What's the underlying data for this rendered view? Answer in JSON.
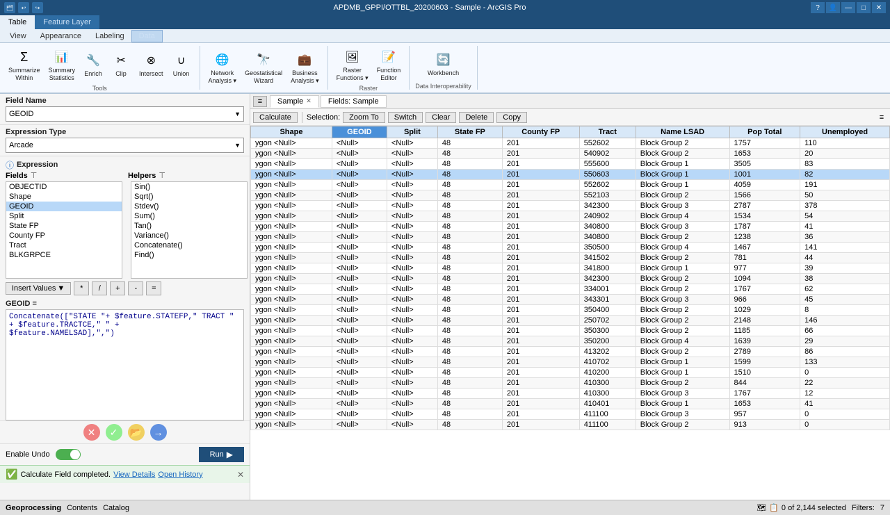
{
  "titleBar": {
    "title": "APDMB_GPPI/OTTBL_20200603 - Sample - ArcGIS Pro",
    "helpIcon": "?",
    "minimizeIcon": "—",
    "maximizeIcon": "□",
    "closeIcon": "✕"
  },
  "ribbon": {
    "tabs": [
      "Table",
      "Feature Layer"
    ],
    "activeTab": "Feature Layer",
    "featureLayerTabs": [
      "View",
      "Appearance",
      "Labeling",
      "Data"
    ],
    "activeFeatureTab": "Data",
    "groups": [
      {
        "label": "Tools",
        "buttons": [
          {
            "icon": "Σ",
            "label": "Summarize\nWithin",
            "name": "summarize-within"
          },
          {
            "icon": "📊",
            "label": "Summary\nStatistics",
            "name": "summary-statistics"
          },
          {
            "icon": "🔧",
            "label": "Enrich",
            "name": "enrich"
          },
          {
            "icon": "✂",
            "label": "Clip",
            "name": "clip"
          },
          {
            "icon": "⊗",
            "label": "Intersect",
            "name": "intersect"
          },
          {
            "icon": "∪",
            "label": "Union",
            "name": "union"
          }
        ]
      },
      {
        "label": "",
        "buttons": [
          {
            "icon": "🌐",
            "label": "Network\nAnalysis ▾",
            "name": "network-analysis"
          },
          {
            "icon": "🔭",
            "label": "Geostatistical\nWizard",
            "name": "geostatistical-wizard"
          },
          {
            "icon": "💼",
            "label": "Business\nAnalysis ▾",
            "name": "business-analysis"
          }
        ]
      },
      {
        "label": "Raster",
        "buttons": [
          {
            "icon": "🖼",
            "label": "Raster\nFunctions ▾",
            "name": "raster-functions"
          },
          {
            "icon": "📝",
            "label": "Function\nEditor",
            "name": "function-editor"
          }
        ]
      },
      {
        "label": "Data Interoperability",
        "buttons": [
          {
            "icon": "🔄",
            "label": "Workbench",
            "name": "workbench"
          }
        ]
      }
    ]
  },
  "leftPanel": {
    "fieldNameLabel": "Field Name",
    "fieldNameValue": "GEOID",
    "expressionTypeLabel": "Expression Type",
    "expressionTypeValue": "Arcade",
    "expressionLabel": "Expression",
    "fieldsHeader": "Fields",
    "helpersHeader": "Helpers",
    "fields": [
      "OBJECTID",
      "Shape",
      "GEOID",
      "Split",
      "State FP",
      "County FP",
      "Tract",
      "BLKGRPCE"
    ],
    "helpers": [
      "Sin()",
      "Sqrt()",
      "Stdev()",
      "Sum()",
      "Tan()",
      "Variance()",
      "Concatenate()",
      "Find()"
    ],
    "insertValuesLabel": "Insert Values",
    "operators": [
      "*",
      "/",
      "+",
      "-",
      "="
    ],
    "expressionFieldLabel": "GEOID =",
    "expressionCode": "Concatenate([\"STATE \"+ $feature.STATEFP,\" TRACT \" + $feature.TRACTCE,\" \" +\n$feature.NAMELSAD],\",\")",
    "enableUndoLabel": "Enable Undo",
    "runLabel": "Run",
    "successMessage": "Calculate Field completed.",
    "viewDetailsLabel": "View Details",
    "openHistoryLabel": "Open History"
  },
  "tablePanel": {
    "tabs": [
      "Sample",
      "Fields: Sample"
    ],
    "activeTab": "Sample",
    "toolbar": {
      "calculateBtn": "Calculate",
      "selectionLabel": "Selection:",
      "zoomToBtn": "Zoom To",
      "switchBtn": "Switch",
      "clearBtn": "Clear",
      "deleteBtn": "Delete",
      "copyBtn": "Copy"
    },
    "columns": [
      "Shape",
      "GEOID",
      "Split",
      "State FP",
      "County FP",
      "Tract",
      "Name LSAD",
      "Pop Total",
      "Unemployed"
    ],
    "rows": [
      {
        "shape": "ygon",
        "geoid": "<Null>",
        "split": "<Null>",
        "statefp": "48",
        "countyfp": "201",
        "tract": "552602",
        "namelsd": "Block Group 2",
        "pop": "1757",
        "unemp": "110"
      },
      {
        "shape": "ygon",
        "geoid": "<Null>",
        "split": "<Null>",
        "statefp": "48",
        "countyfp": "201",
        "tract": "540902",
        "namelsd": "Block Group 2",
        "pop": "1653",
        "unemp": "20"
      },
      {
        "shape": "ygon",
        "geoid": "<Null>",
        "split": "<Null>",
        "statefp": "48",
        "countyfp": "201",
        "tract": "555600",
        "namelsd": "Block Group 1",
        "pop": "3505",
        "unemp": "83"
      },
      {
        "shape": "ygon",
        "geoid": "<Null>",
        "split": "<Null>",
        "statefp": "48",
        "countyfp": "201",
        "tract": "550603",
        "namelsd": "Block Group 1",
        "pop": "1001",
        "unemp": "82",
        "selected": true
      },
      {
        "shape": "ygon",
        "geoid": "<Null>",
        "split": "<Null>",
        "statefp": "48",
        "countyfp": "201",
        "tract": "552602",
        "namelsd": "Block Group 1",
        "pop": "4059",
        "unemp": "191"
      },
      {
        "shape": "ygon",
        "geoid": "<Null>",
        "split": "<Null>",
        "statefp": "48",
        "countyfp": "201",
        "tract": "552103",
        "namelsd": "Block Group 2",
        "pop": "1566",
        "unemp": "50"
      },
      {
        "shape": "ygon",
        "geoid": "<Null>",
        "split": "<Null>",
        "statefp": "48",
        "countyfp": "201",
        "tract": "342300",
        "namelsd": "Block Group 3",
        "pop": "2787",
        "unemp": "378"
      },
      {
        "shape": "ygon",
        "geoid": "<Null>",
        "split": "<Null>",
        "statefp": "48",
        "countyfp": "201",
        "tract": "240902",
        "namelsd": "Block Group 4",
        "pop": "1534",
        "unemp": "54"
      },
      {
        "shape": "ygon",
        "geoid": "<Null>",
        "split": "<Null>",
        "statefp": "48",
        "countyfp": "201",
        "tract": "340800",
        "namelsd": "Block Group 3",
        "pop": "1787",
        "unemp": "41"
      },
      {
        "shape": "ygon",
        "geoid": "<Null>",
        "split": "<Null>",
        "statefp": "48",
        "countyfp": "201",
        "tract": "340800",
        "namelsd": "Block Group 2",
        "pop": "1238",
        "unemp": "36"
      },
      {
        "shape": "ygon",
        "geoid": "<Null>",
        "split": "<Null>",
        "statefp": "48",
        "countyfp": "201",
        "tract": "350500",
        "namelsd": "Block Group 4",
        "pop": "1467",
        "unemp": "141"
      },
      {
        "shape": "ygon",
        "geoid": "<Null>",
        "split": "<Null>",
        "statefp": "48",
        "countyfp": "201",
        "tract": "341502",
        "namelsd": "Block Group 2",
        "pop": "781",
        "unemp": "44"
      },
      {
        "shape": "ygon",
        "geoid": "<Null>",
        "split": "<Null>",
        "statefp": "48",
        "countyfp": "201",
        "tract": "341800",
        "namelsd": "Block Group 1",
        "pop": "977",
        "unemp": "39"
      },
      {
        "shape": "ygon",
        "geoid": "<Null>",
        "split": "<Null>",
        "statefp": "48",
        "countyfp": "201",
        "tract": "342300",
        "namelsd": "Block Group 2",
        "pop": "1094",
        "unemp": "38"
      },
      {
        "shape": "ygon",
        "geoid": "<Null>",
        "split": "<Null>",
        "statefp": "48",
        "countyfp": "201",
        "tract": "334001",
        "namelsd": "Block Group 2",
        "pop": "1767",
        "unemp": "62"
      },
      {
        "shape": "ygon",
        "geoid": "<Null>",
        "split": "<Null>",
        "statefp": "48",
        "countyfp": "201",
        "tract": "343301",
        "namelsd": "Block Group 3",
        "pop": "966",
        "unemp": "45"
      },
      {
        "shape": "ygon",
        "geoid": "<Null>",
        "split": "<Null>",
        "statefp": "48",
        "countyfp": "201",
        "tract": "350400",
        "namelsd": "Block Group 2",
        "pop": "1029",
        "unemp": "8"
      },
      {
        "shape": "ygon",
        "geoid": "<Null>",
        "split": "<Null>",
        "statefp": "48",
        "countyfp": "201",
        "tract": "250702",
        "namelsd": "Block Group 2",
        "pop": "2148",
        "unemp": "146"
      },
      {
        "shape": "ygon",
        "geoid": "<Null>",
        "split": "<Null>",
        "statefp": "48",
        "countyfp": "201",
        "tract": "350300",
        "namelsd": "Block Group 2",
        "pop": "1185",
        "unemp": "66"
      },
      {
        "shape": "ygon",
        "geoid": "<Null>",
        "split": "<Null>",
        "statefp": "48",
        "countyfp": "201",
        "tract": "350200",
        "namelsd": "Block Group 4",
        "pop": "1639",
        "unemp": "29"
      },
      {
        "shape": "ygon",
        "geoid": "<Null>",
        "split": "<Null>",
        "statefp": "48",
        "countyfp": "201",
        "tract": "413202",
        "namelsd": "Block Group 2",
        "pop": "2789",
        "unemp": "86"
      },
      {
        "shape": "ygon",
        "geoid": "<Null>",
        "split": "<Null>",
        "statefp": "48",
        "countyfp": "201",
        "tract": "410702",
        "namelsd": "Block Group 1",
        "pop": "1599",
        "unemp": "133"
      },
      {
        "shape": "ygon",
        "geoid": "<Null>",
        "split": "<Null>",
        "statefp": "48",
        "countyfp": "201",
        "tract": "410200",
        "namelsd": "Block Group 1",
        "pop": "1510",
        "unemp": "0"
      },
      {
        "shape": "ygon",
        "geoid": "<Null>",
        "split": "<Null>",
        "statefp": "48",
        "countyfp": "201",
        "tract": "410300",
        "namelsd": "Block Group 2",
        "pop": "844",
        "unemp": "22"
      },
      {
        "shape": "ygon",
        "geoid": "<Null>",
        "split": "<Null>",
        "statefp": "48",
        "countyfp": "201",
        "tract": "410300",
        "namelsd": "Block Group 3",
        "pop": "1767",
        "unemp": "12"
      },
      {
        "shape": "ygon",
        "geoid": "<Null>",
        "split": "<Null>",
        "statefp": "48",
        "countyfp": "201",
        "tract": "410401",
        "namelsd": "Block Group 1",
        "pop": "1653",
        "unemp": "41"
      },
      {
        "shape": "ygon",
        "geoid": "<Null>",
        "split": "<Null>",
        "statefp": "48",
        "countyfp": "201",
        "tract": "411100",
        "namelsd": "Block Group 3",
        "pop": "957",
        "unemp": "0"
      },
      {
        "shape": "ygon",
        "geoid": "<Null>",
        "split": "<Null>",
        "statefp": "48",
        "countyfp": "201",
        "tract": "411100",
        "namelsd": "Block Group 2",
        "pop": "913",
        "unemp": "0"
      }
    ]
  },
  "statusBar": {
    "geoprocessingLabel": "Geoprocessing",
    "contentsLabel": "Contents",
    "catalogLabel": "Catalog",
    "recordCount": "0 of 2,144 selected",
    "filtersLabel": "Filters:",
    "filterCount": "7"
  }
}
